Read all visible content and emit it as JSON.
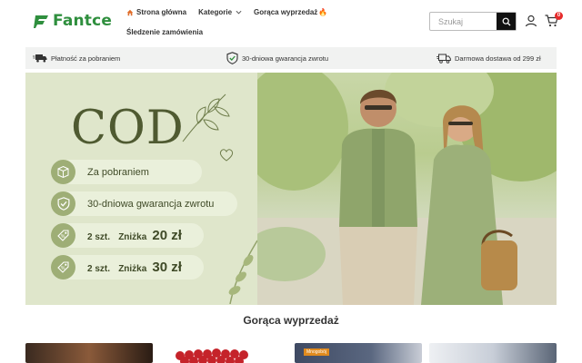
{
  "header": {
    "logo_text": "Fantce",
    "nav": [
      {
        "label": "Strona główna",
        "icon": "home-icon"
      },
      {
        "label": "Kategorie",
        "icon": "chevron-down-icon"
      },
      {
        "label": "Gorąca wyprzedaż",
        "icon": "fire-icon"
      },
      {
        "label": "Śledzenie zamówienia"
      }
    ],
    "search": {
      "placeholder": "Szukaj",
      "icon": "search-icon"
    },
    "cart_count": "0",
    "colors": {
      "brand": "#2f8f3e",
      "badge": "#e62c2c"
    }
  },
  "benefits": [
    {
      "label": "Płatność za pobraniem",
      "icon": "truck-icon"
    },
    {
      "label": "30-dniowa gwarancja zwrotu",
      "icon": "shield-check-icon"
    },
    {
      "label": "Darmowa dostawa od 299 zł",
      "icon": "delivery-icon"
    }
  ],
  "hero": {
    "headline": "COD",
    "pills": [
      {
        "label": "Za pobraniem",
        "icon": "box-icon"
      },
      {
        "label": "30-dniowa gwarancja zwrotu",
        "icon": "shield-check-icon"
      },
      {
        "qty": "2 szt.",
        "discount_label": "Zniżka",
        "amount": "20 zł",
        "icon": "tag-icon"
      },
      {
        "qty": "2 szt.",
        "discount_label": "Zniżka",
        "amount": "30 zł",
        "icon": "tag-icon"
      }
    ]
  },
  "section": {
    "title": "Gorąca wyprzedaż"
  },
  "products": [
    {
      "tag": ""
    },
    {
      "tag": ""
    },
    {
      "tag": "Mnogobój"
    },
    {
      "tag": ""
    }
  ]
}
